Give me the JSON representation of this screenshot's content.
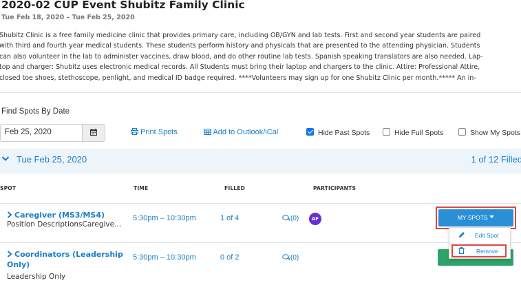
{
  "event": {
    "title": "2020-02 CUP Event Shubitz Family Clinic",
    "date_range": "Tue Feb 18, 2020 – Tue Feb 25, 2020",
    "description_lines": [
      "Shubitz Clinic is a free family medicine clinic that provides primary care, including OB/GYN and lab tests. First and second year students are paired",
      "with third and fourth year medical students. These students perform history and physicals that are presented to the attending physician. Students",
      "can also volunteer in the lab to administer vaccines, draw blood, and do other routine lab tests. Spanish speaking translators are also needed. Lap-",
      "top and charger: Shubitz uses electronic medical records. All Students must bring their laptop and chargers to the clinic. Attire: Professional Attire,",
      "closed toe shoes, stethoscope, penlight, and medical ID badge required. ****Volunteers may sign up for one Shubitz Clinic per month.***** An in-"
    ]
  },
  "filters": {
    "find_label": "Find Spots By Date",
    "date_value": "Feb 25, 2020",
    "calendar_icon": "calendar-icon",
    "print_label": "Print Spots",
    "add_calendar_label": "Add to Outlook/iCal",
    "hide_past_label": "Hide Past Spots",
    "hide_past_checked": true,
    "hide_full_label": "Hide Full Spots",
    "hide_full_checked": false,
    "show_mine_label": "Show My Spots",
    "show_mine_checked": false
  },
  "date_group": {
    "date": "Tue Feb 25, 2020",
    "filled": "1 of 12 Filled"
  },
  "table": {
    "headers": [
      "SPOT",
      "TIME",
      "FILLED",
      "PARTICIPANTS"
    ],
    "rows": [
      {
        "name": "Caregiver (MS3/MS4)",
        "subtitle": "Position DescriptionsCaregive…",
        "time": "5:30pm – 10:30pm",
        "filled": "1 of 4",
        "comments": "(0)",
        "participant_initials": "AF"
      },
      {
        "name": "Coordinators (Leadership Only)",
        "subtitle": "Leadership Only",
        "time": "5:30pm – 10:30pm",
        "filled": "0 of 2",
        "comments": "(0)"
      }
    ]
  },
  "actions": {
    "my_spots_label": "MY SPOTS",
    "edit_spot_label": "Edit Spot",
    "remove_label": "Remove"
  },
  "colors": {
    "link": "#1a7dc7",
    "highlight_box": "#e0453c",
    "my_spots_bg": "#2a8fd6",
    "avatar_bg": "#6a2bd9",
    "date_bar_bg": "#edf4fa"
  }
}
